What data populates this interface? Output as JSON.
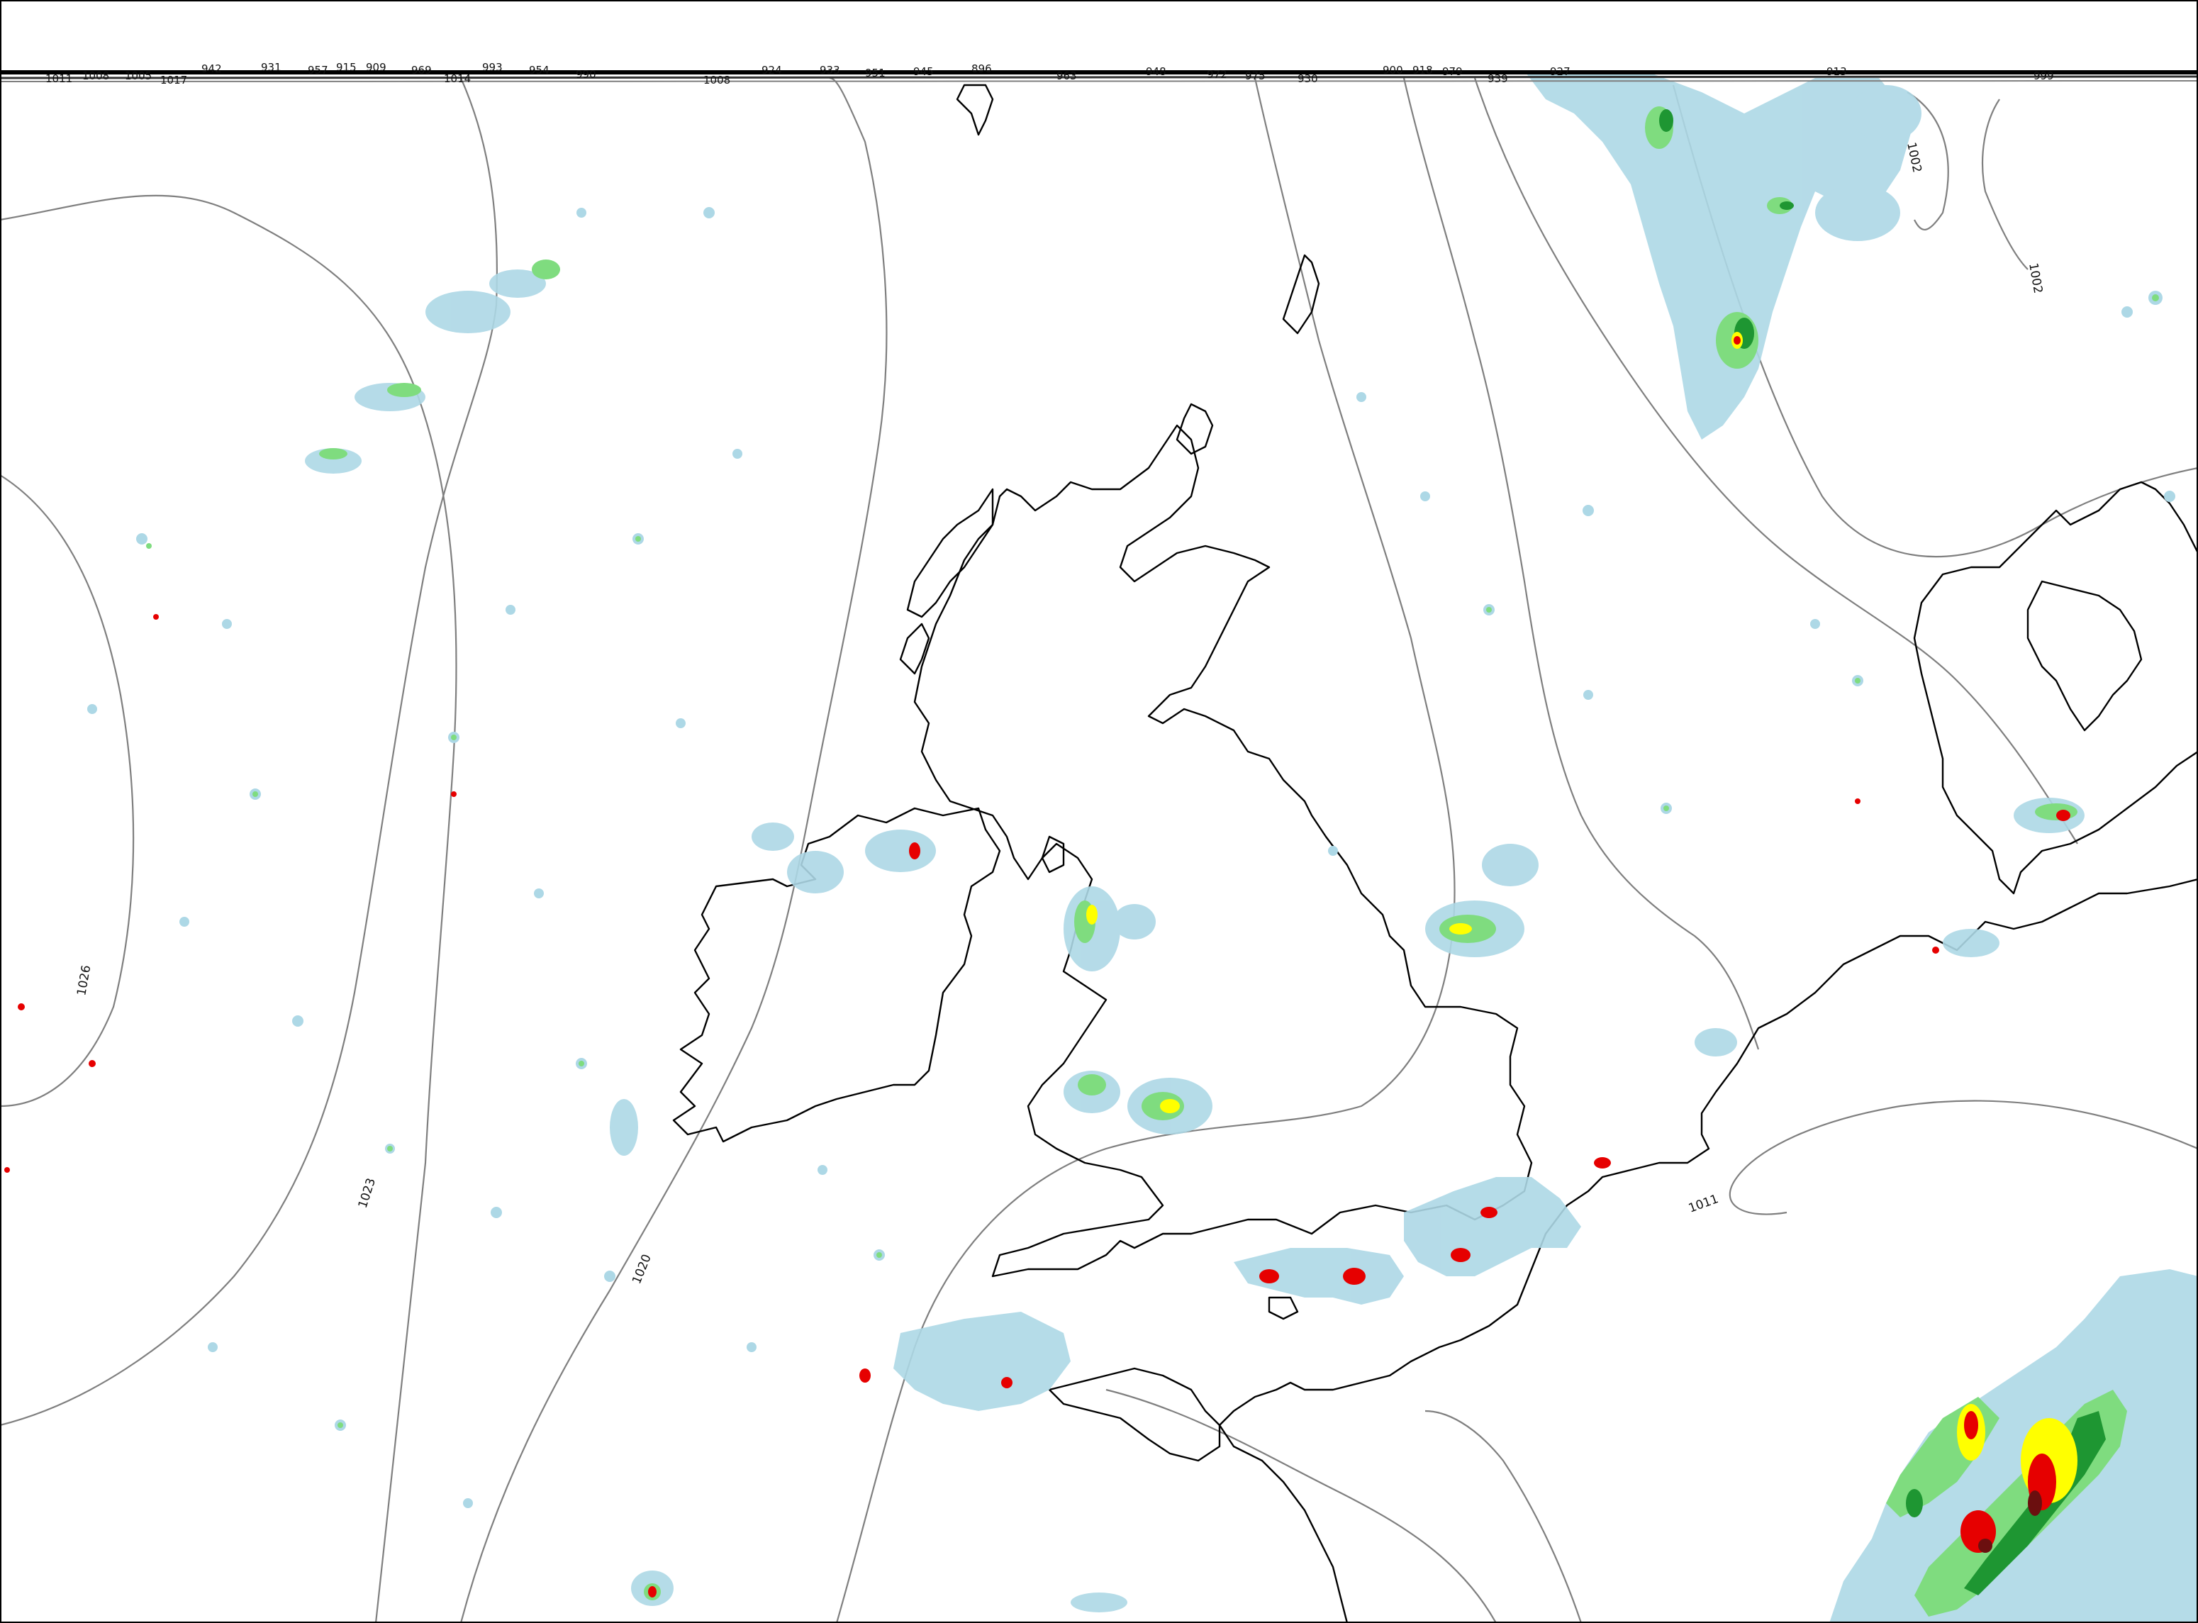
{
  "map": {
    "colors": {
      "background": "#ffffff",
      "coastline": "#000000",
      "isobar": "#7f7f7f",
      "precip_light": "#add8e6",
      "precip_moderate": "#7fdc7f",
      "precip_heavy_green": "#1e9632",
      "precip_yellow": "#ffff00",
      "precip_orange": "#ff8c00",
      "precip_red": "#e60000",
      "precip_dark": "#6b0f0f"
    },
    "isobar_labels": [
      "1026",
      "1023",
      "1020",
      "1011",
      "1002",
      "1002"
    ],
    "top_edge_labels": [
      "1011",
      "1008",
      "1005",
      "1017",
      "942",
      "931",
      "957",
      "915",
      "909",
      "969",
      "1014",
      "993",
      "954",
      "990",
      "1008",
      "924",
      "933",
      "951",
      "945",
      "896",
      "963",
      "948",
      "972",
      "975",
      "930",
      "900",
      "918",
      "979",
      "939",
      "927",
      "913",
      "999"
    ]
  }
}
